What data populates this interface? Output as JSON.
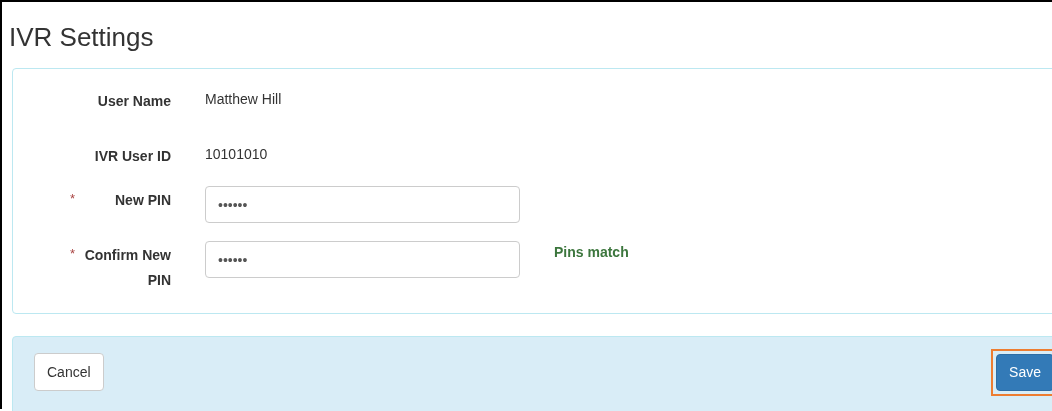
{
  "page": {
    "title": "IVR Settings"
  },
  "fields": [
    {
      "kind": "text",
      "label": "User Name",
      "value": "Matthew Hill"
    },
    {
      "kind": "text",
      "label": "IVR User ID",
      "value": "10101010"
    },
    {
      "kind": "password",
      "label": "New PIN",
      "required_mark": "*",
      "value": "••••••"
    },
    {
      "kind": "password",
      "label": "Confirm New PIN",
      "required_mark": "*",
      "value": "••••••",
      "message": "Pins match"
    }
  ],
  "footer": {
    "buttons": [
      {
        "label": "Cancel",
        "kind": "default",
        "highlighted": false
      },
      {
        "label": "Save",
        "kind": "primary",
        "highlighted": true
      }
    ]
  }
}
